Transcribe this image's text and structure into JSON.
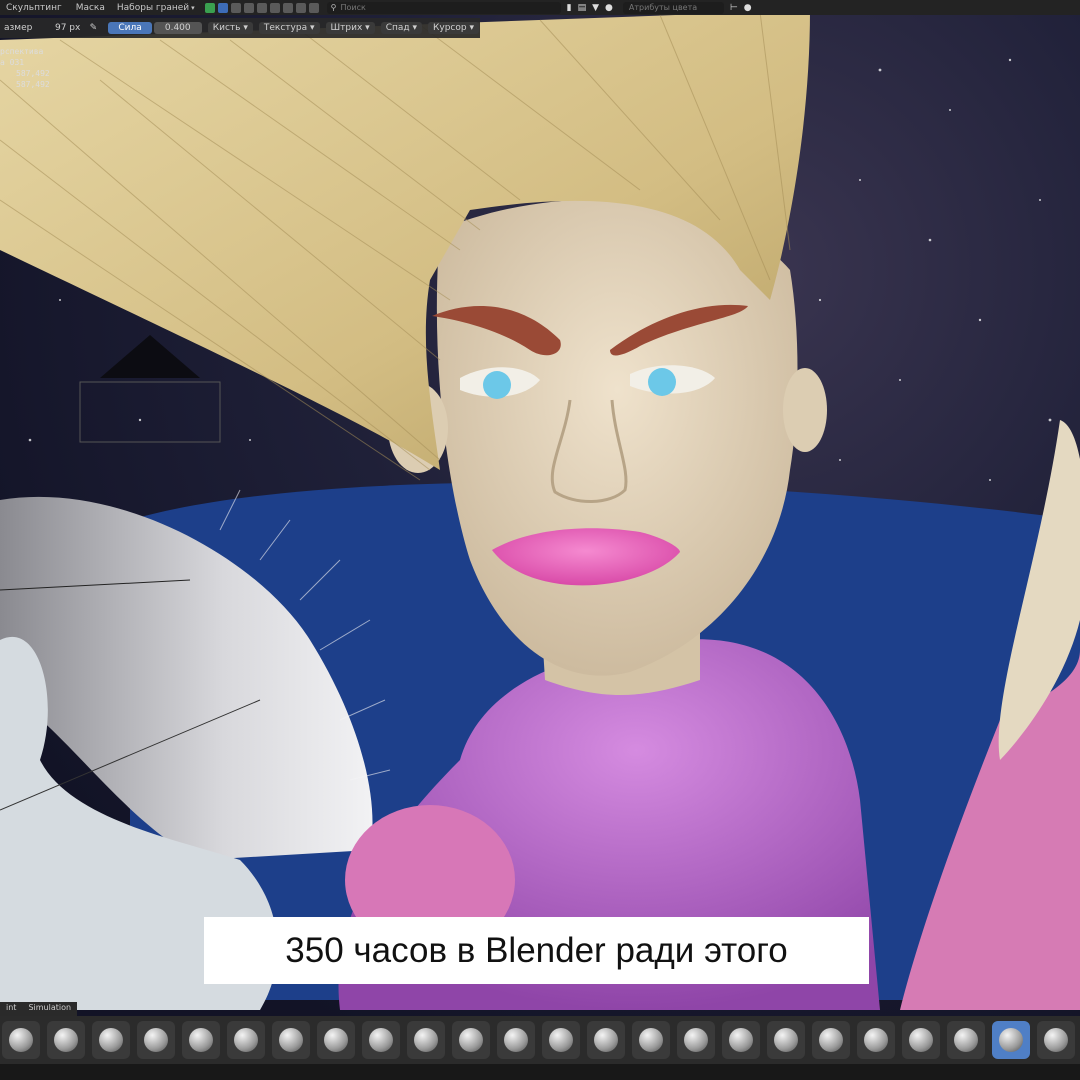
{
  "menubar": {
    "items": [
      "Скульптинг",
      "Маска",
      "Наборы граней"
    ],
    "search_placeholder": "Поиск",
    "attribute_placeholder": "Атрибуты цвета"
  },
  "tool_header": {
    "size_label": "азмер",
    "size_value": "97 px",
    "strength_label": "Сила",
    "strength_value": "0.400",
    "brush_label": "Кисть",
    "texture_label": "Текстура",
    "stroke_label": "Штрих",
    "falloff_label": "Спад",
    "cursor_label": "Курсор"
  },
  "viewport": {
    "lines": [
      "рспектива",
      "а 031"
    ],
    "coords": [
      "587,492",
      "587,492"
    ]
  },
  "caption": "350 часов в Blender ради этого",
  "workspace_tabs": [
    "int",
    "Simulation"
  ],
  "brushes": {
    "count": 24,
    "active_index": 22
  },
  "colors": {
    "active_accent": "#4a76b8",
    "caption_bg": "#ffffff",
    "lips": "#e060b0",
    "shirt": "#b968c9",
    "hair": "#d9c48f",
    "eyes": "#6cc8e8"
  }
}
